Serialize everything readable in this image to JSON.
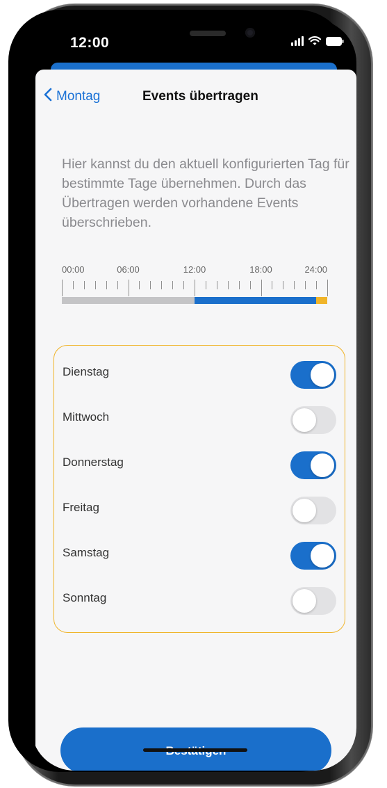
{
  "status_bar": {
    "time": "12:00"
  },
  "nav": {
    "back_label": "Montag",
    "title": "Events übertragen"
  },
  "description": "Hier kannst du den aktuell konfigurierten Tag für bestimmte Tage übernehmen. Durch das Übertragen werden vorhandene Events überschrieben.",
  "timeline": {
    "labels": [
      "00:00",
      "06:00",
      "12:00",
      "18:00",
      "24:00"
    ],
    "segments": [
      {
        "from_hour": 0,
        "to_hour": 12,
        "color": "#c4c4c6"
      },
      {
        "from_hour": 12,
        "to_hour": 23,
        "color": "#1a6fcb"
      },
      {
        "from_hour": 23,
        "to_hour": 24,
        "color": "#f0b429"
      }
    ]
  },
  "days": [
    {
      "label": "Dienstag",
      "enabled": true
    },
    {
      "label": "Mittwoch",
      "enabled": false
    },
    {
      "label": "Donnerstag",
      "enabled": true
    },
    {
      "label": "Freitag",
      "enabled": false
    },
    {
      "label": "Samstag",
      "enabled": true
    },
    {
      "label": "Sonntag",
      "enabled": false
    }
  ],
  "confirm_label": "Bestätigen",
  "colors": {
    "accent": "#1a6fcb",
    "highlight_border": "#f0b429",
    "toggle_off": "#e2e2e4"
  }
}
